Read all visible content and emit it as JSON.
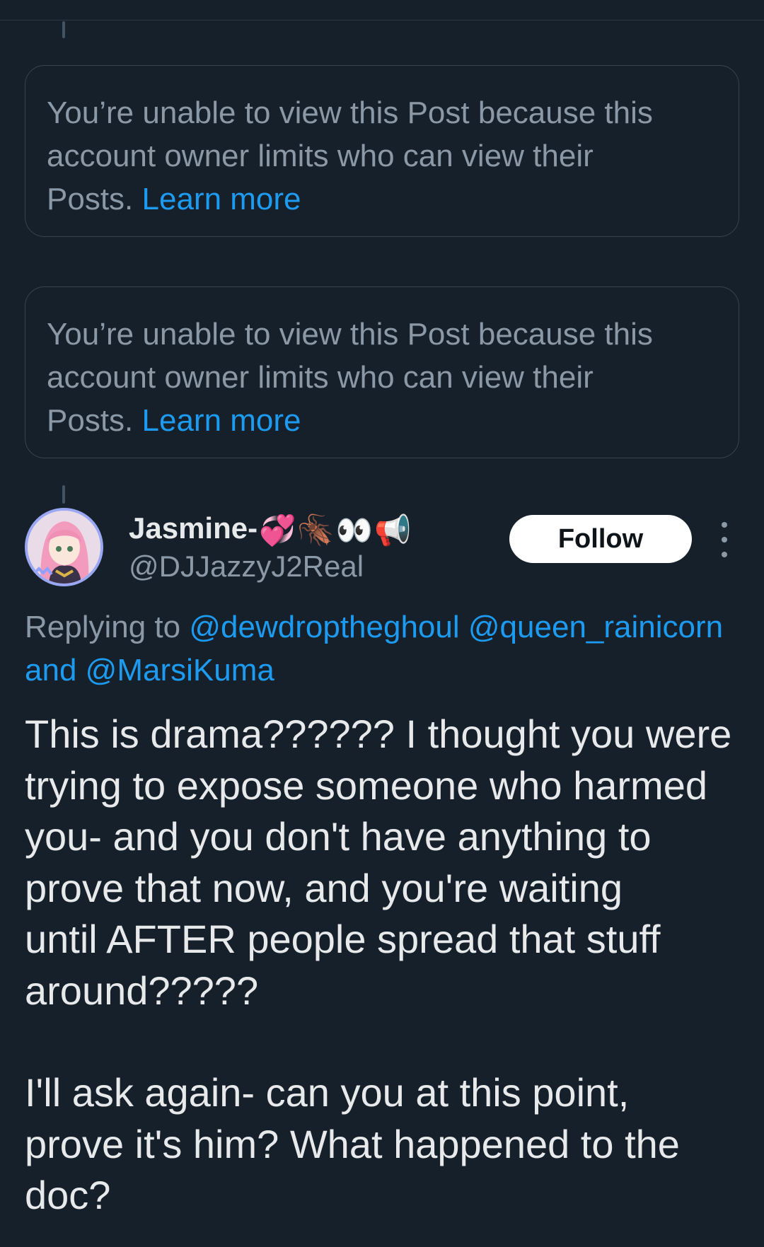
{
  "restricted_posts": [
    {
      "lines": [
        "You’re unable to view this Post because this",
        "account owner limits who can view their"
      ],
      "last_line_prefix": "Posts.",
      "link_label": "Learn more"
    },
    {
      "lines": [
        "You’re unable to view this Post because this",
        "account owner limits who can view their"
      ],
      "last_line_prefix": "Posts.",
      "link_label": "Learn more"
    }
  ],
  "tweet": {
    "display_name": "Jasmine-",
    "name_emojis": [
      "💞",
      "🪳",
      "👀",
      "📢"
    ],
    "handle": "@DJJazzyJ2Real",
    "follow_label": "Follow",
    "replying_prefix": "Replying to",
    "mentions": [
      "@dewdroptheghoul",
      "@queen_rainicorn",
      "@MarsiKuma"
    ],
    "replying_and": "and",
    "paragraph_1": [
      "This is drama?????? I thought you were",
      "trying to expose someone who harmed",
      "you- and you don't have anything to",
      "prove that now, and you're waiting",
      "until AFTER people spread that stuff",
      "around?????"
    ],
    "paragraph_2": [
      "I'll ask again- can you at this point,",
      "prove it's him? What happened to the",
      "doc?"
    ]
  },
  "icons": {
    "more": "more-vertical-icon",
    "avatar": "anime-avatar"
  }
}
